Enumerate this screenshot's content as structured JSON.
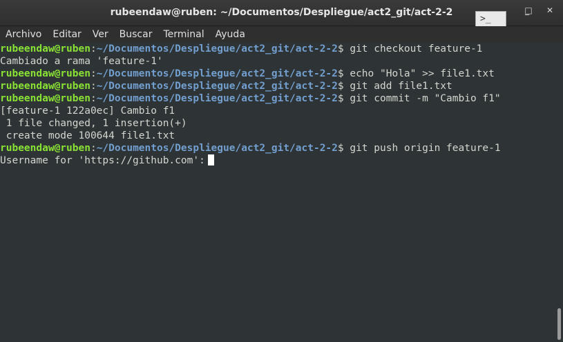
{
  "window": {
    "title": "rubeendaw@ruben: ~/Documentos/Despliegue/act2_git/act-2-2",
    "minimize_glyph": "_",
    "maximize_glyph": "□",
    "close_glyph": "✕",
    "task_icon_glyph": ">_"
  },
  "menu": {
    "items": [
      "Archivo",
      "Editar",
      "Ver",
      "Buscar",
      "Terminal",
      "Ayuda"
    ]
  },
  "terminal": {
    "prompt_user": "rubeendaw@ruben",
    "prompt_path": "~/Documentos/Despliegue/act2_git/act-2-2",
    "lines": [
      {
        "type": "cmd",
        "text": "git checkout feature-1"
      },
      {
        "type": "out",
        "text": "Cambiado a rama 'feature-1'"
      },
      {
        "type": "cmd",
        "text": "echo \"Hola\" >> file1.txt"
      },
      {
        "type": "cmd",
        "text": "git add file1.txt"
      },
      {
        "type": "cmd",
        "text": "git commit -m \"Cambio f1\""
      },
      {
        "type": "out",
        "text": "[feature-1 122a0ec] Cambio f1"
      },
      {
        "type": "out",
        "text": " 1 file changed, 1 insertion(+)"
      },
      {
        "type": "out",
        "text": " create mode 100644 file1.txt"
      },
      {
        "type": "cmd",
        "text": "git push origin feature-1"
      },
      {
        "type": "input",
        "text": "Username for 'https://github.com':"
      }
    ]
  }
}
